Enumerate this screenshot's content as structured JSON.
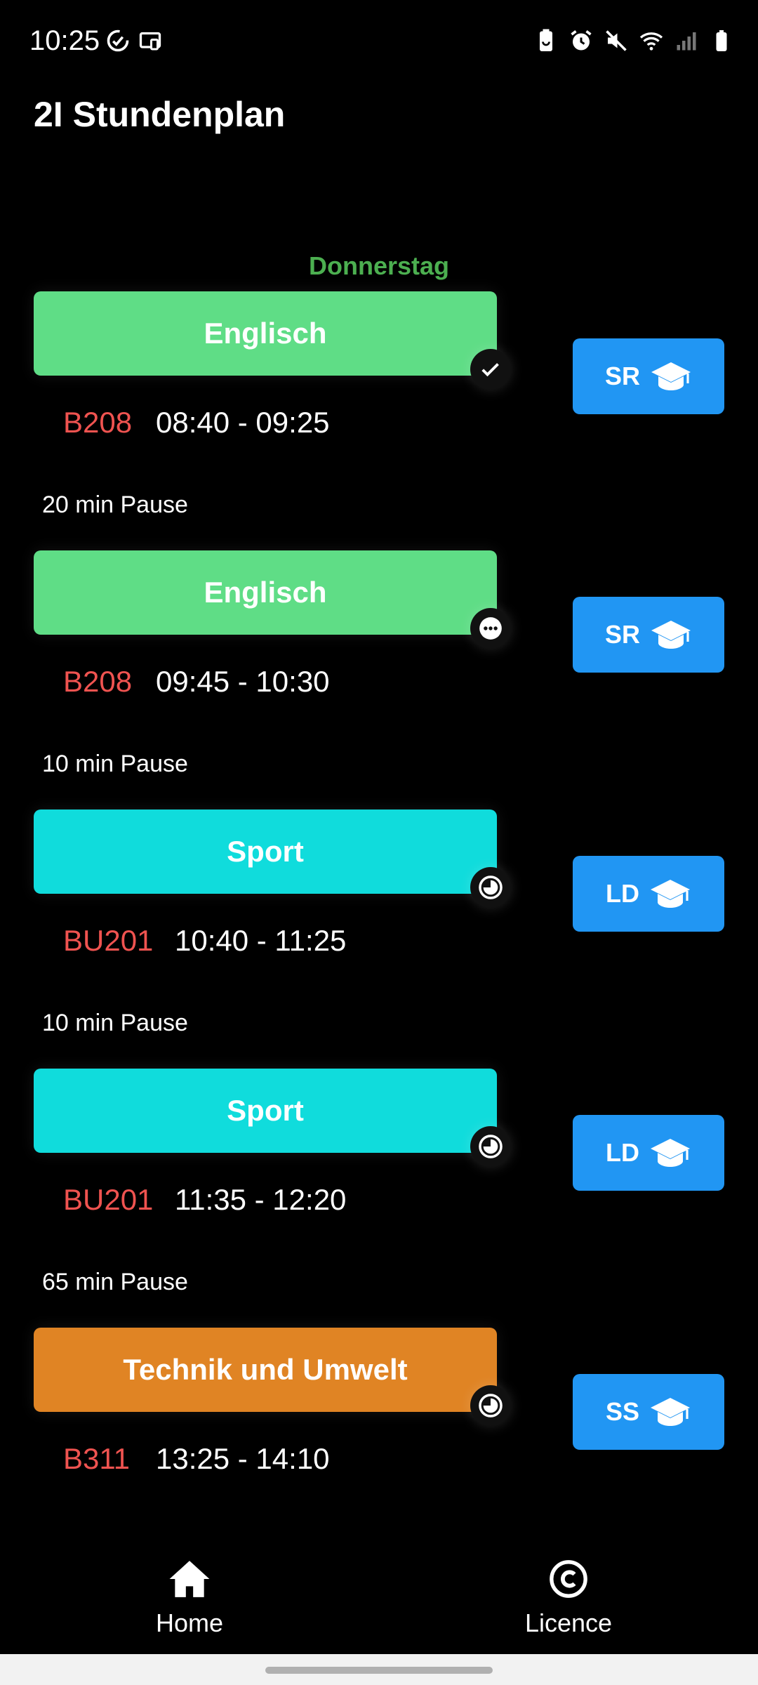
{
  "status_bar": {
    "time": "10:25",
    "left_icons": [
      "sync-check-icon",
      "cast-icon"
    ],
    "right_icons": [
      "battery-saver-icon",
      "alarm-icon",
      "mute-icon",
      "wifi-icon",
      "signal-icon",
      "battery-icon"
    ]
  },
  "app": {
    "title": "2I Stundenplan"
  },
  "day": {
    "label": "Donnerstag"
  },
  "colors": {
    "english": "#5fdd86",
    "sport": "#10dcdc",
    "technik": "#e08424",
    "room": "#ef5350",
    "teacher_button": "#2196f3",
    "day_label": "#4caf50"
  },
  "lessons": [
    {
      "subject": "Englisch",
      "room": "B208",
      "time": "08:40 - 09:25",
      "teacher": "SR",
      "status_icon": "check-icon"
    },
    {
      "subject": "Englisch",
      "room": "B208",
      "time": "09:45 - 10:30",
      "teacher": "SR",
      "status_icon": "more-horiz-icon"
    },
    {
      "subject": "Sport",
      "room": "BU201",
      "time": "10:40 - 11:25",
      "teacher": "LD",
      "status_icon": "pending-icon"
    },
    {
      "subject": "Sport",
      "room": "BU201",
      "time": "11:35 - 12:20",
      "teacher": "LD",
      "status_icon": "pending-icon"
    },
    {
      "subject": "Technik und Umwelt",
      "room": "B311",
      "time": "13:25 - 14:10",
      "teacher": "SS",
      "status_icon": "pending-icon"
    }
  ],
  "pauses": [
    "20 min Pause",
    "10 min Pause",
    "10 min Pause",
    "65 min Pause"
  ],
  "bottom_nav": {
    "home_label": "Home",
    "licence_label": "Licence"
  }
}
